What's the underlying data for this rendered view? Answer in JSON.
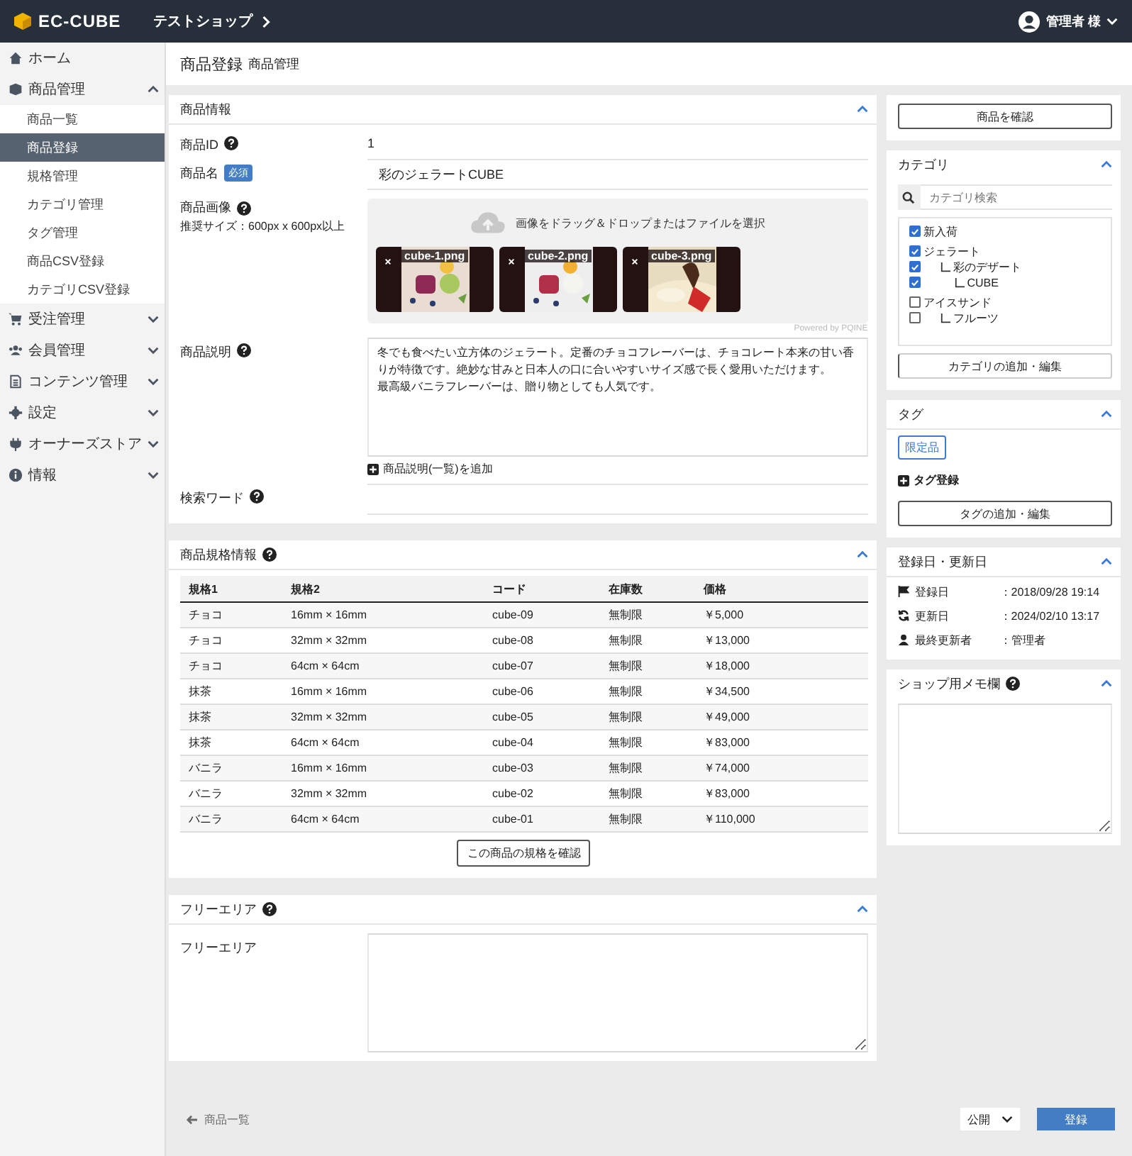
{
  "header": {
    "logo": "EC-CUBE",
    "shop": "テストショップ",
    "user": "管理者 様"
  },
  "sidebar": {
    "items": [
      {
        "label": "ホーム",
        "kind": "link"
      },
      {
        "label": "商品管理",
        "kind": "group",
        "expanded": true,
        "children": [
          {
            "label": "商品一覧",
            "selected": false
          },
          {
            "label": "商品登録",
            "selected": true
          },
          {
            "label": "規格管理",
            "selected": false
          },
          {
            "label": "カテゴリ管理",
            "selected": false
          },
          {
            "label": "タグ管理",
            "selected": false
          },
          {
            "label": "商品CSV登録",
            "selected": false
          },
          {
            "label": "カテゴリCSV登録",
            "selected": false
          }
        ]
      },
      {
        "label": "受注管理",
        "kind": "group",
        "expanded": false
      },
      {
        "label": "会員管理",
        "kind": "group",
        "expanded": false
      },
      {
        "label": "コンテンツ管理",
        "kind": "group",
        "expanded": false
      },
      {
        "label": "設定",
        "kind": "group",
        "expanded": false
      },
      {
        "label": "オーナーズストア",
        "kind": "group",
        "expanded": false
      },
      {
        "label": "情報",
        "kind": "group",
        "expanded": false
      }
    ]
  },
  "page": {
    "title": "商品登録",
    "breadcrumb": "商品管理"
  },
  "product_info": {
    "title": "商品情報",
    "id_label": "商品ID",
    "id": "1",
    "name_label": "商品名",
    "required": "必須",
    "name": "彩のジェラートCUBE",
    "image_label": "商品画像",
    "image_hint": "推奨サイズ：600px x 600px以上",
    "dropzone": "画像をドラッグ＆ドロップまたはファイルを選択",
    "images": [
      {
        "file": "cube-1.png"
      },
      {
        "file": "cube-2.png"
      },
      {
        "file": "cube-3.png"
      }
    ],
    "powered": "Powered by PQINE",
    "description_label": "商品説明",
    "description": [
      "冬でも食べたい立方体のジェラート。定番のチョコフレーバーは、チョコレート本来の甘い香りが特徴です。絶妙な甘みと日本人の口に合いやすいサイズ感で長く愛用いただけます。",
      "最高級バニラフレーバーは、贈り物としても人気です。"
    ],
    "add_description": "商品説明(一覧)を追加",
    "keyword_label": "検索ワード"
  },
  "spec": {
    "title": "商品規格情報",
    "columns": [
      "規格1",
      "規格2",
      "コード",
      "在庫数",
      "価格"
    ],
    "rows": [
      [
        "チョコ",
        "16mm × 16mm",
        "cube-09",
        "無制限",
        "￥5,000"
      ],
      [
        "チョコ",
        "32mm × 32mm",
        "cube-08",
        "無制限",
        "￥13,000"
      ],
      [
        "チョコ",
        "64cm × 64cm",
        "cube-07",
        "無制限",
        "￥18,000"
      ],
      [
        "抹茶",
        "16mm × 16mm",
        "cube-06",
        "無制限",
        "￥34,500"
      ],
      [
        "抹茶",
        "32mm × 32mm",
        "cube-05",
        "無制限",
        "￥49,000"
      ],
      [
        "抹茶",
        "64cm × 64cm",
        "cube-04",
        "無制限",
        "￥83,000"
      ],
      [
        "バニラ",
        "16mm × 16mm",
        "cube-03",
        "無制限",
        "￥74,000"
      ],
      [
        "バニラ",
        "32mm × 32mm",
        "cube-02",
        "無制限",
        "￥83,000"
      ],
      [
        "バニラ",
        "64cm × 64cm",
        "cube-01",
        "無制限",
        "￥110,000"
      ]
    ],
    "button": "この商品の規格を確認"
  },
  "free_area": {
    "title": "フリーエリア",
    "label": "フリーエリア"
  },
  "confirm_button": "商品を確認",
  "category": {
    "title": "カテゴリ",
    "search_placeholder": "カテゴリ検索",
    "tree": [
      {
        "label": "新入荷",
        "checked": true
      },
      {
        "label": "ジェラート",
        "checked": true,
        "children": [
          {
            "label": "彩のデザート",
            "checked": true,
            "children": [
              {
                "label": "CUBE",
                "checked": true
              }
            ]
          }
        ]
      },
      {
        "label": "アイスサンド",
        "checked": false,
        "children": [
          {
            "label": "フルーツ",
            "checked": false
          }
        ]
      }
    ],
    "button": "カテゴリの追加・編集"
  },
  "tag": {
    "title": "タグ",
    "tags": [
      {
        "label": "限定品",
        "selected": true
      }
    ],
    "add": "タグ登録",
    "button": "タグの追加・編集"
  },
  "dates": {
    "title": "登録日・更新日",
    "rows": [
      {
        "label": "登録日",
        "value": "：2018/09/28 19:14"
      },
      {
        "label": "更新日",
        "value": "：2024/02/10 13:17"
      },
      {
        "label": "最終更新者",
        "value": "：管理者"
      }
    ]
  },
  "memo": {
    "title": "ショップ用メモ欄"
  },
  "footer": {
    "back": "商品一覧",
    "status": "公開",
    "submit": "登録"
  }
}
